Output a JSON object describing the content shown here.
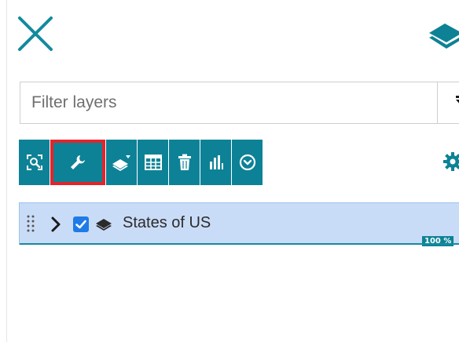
{
  "header": {
    "close_icon": "close-icon",
    "layers_icon": "layers-icon"
  },
  "filter": {
    "placeholder": "Filter layers",
    "value": "",
    "filter_icon": "funnel-icon"
  },
  "toolbar": {
    "buttons": [
      {
        "icon": "zoom-to-layer-icon",
        "selected": false
      },
      {
        "icon": "wrench-icon",
        "selected": true
      },
      {
        "icon": "style-layer-icon",
        "selected": false
      },
      {
        "icon": "attribute-table-icon",
        "selected": false
      },
      {
        "icon": "trash-icon",
        "selected": false
      },
      {
        "icon": "chart-icon",
        "selected": false
      },
      {
        "icon": "download-icon",
        "selected": false
      }
    ],
    "settings_icon": "gear-icon"
  },
  "layers": [
    {
      "name": "States of US",
      "visible": true,
      "progress_label": "100 %",
      "progress": 100
    }
  ],
  "colors": {
    "accent": "#0d8296",
    "selected_outline": "#e3242b",
    "row_highlight": "#c9dcf7",
    "checkbox": "#1e7be8"
  }
}
